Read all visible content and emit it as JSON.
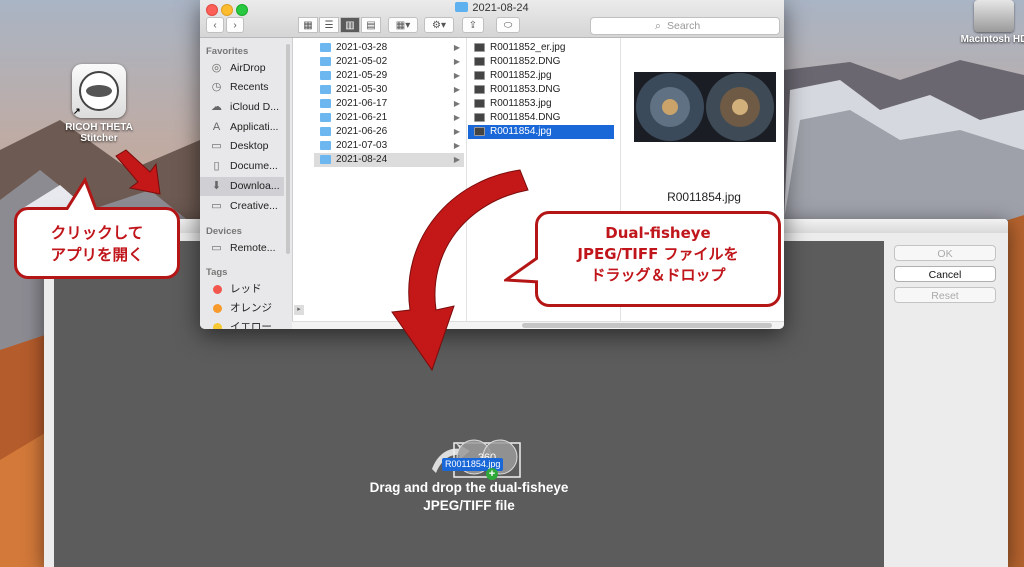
{
  "desktop": {
    "app_icon_label_line1": "RICOH THETA",
    "app_icon_label_line2": "Stitcher",
    "drive_label": "Macintosh HD"
  },
  "finder": {
    "window_title": "2021-08-24",
    "search_placeholder": "Search",
    "sidebar": {
      "favorites_header": "Favorites",
      "favorites": [
        {
          "label": "AirDrop",
          "icon": "airdrop-icon"
        },
        {
          "label": "Recents",
          "icon": "clock-icon"
        },
        {
          "label": "iCloud D...",
          "icon": "cloud-icon"
        },
        {
          "label": "Applicati...",
          "icon": "applications-icon"
        },
        {
          "label": "Desktop",
          "icon": "desktop-icon"
        },
        {
          "label": "Docume...",
          "icon": "document-icon"
        },
        {
          "label": "Downloa...",
          "icon": "download-icon"
        },
        {
          "label": "Creative...",
          "icon": "folder-icon"
        }
      ],
      "devices_header": "Devices",
      "devices": [
        {
          "label": "Remote...",
          "icon": "display-icon"
        }
      ],
      "tags_header": "Tags",
      "tags": [
        {
          "label": "レッド",
          "color": "#f2574d"
        },
        {
          "label": "オレンジ",
          "color": "#f79a2b"
        },
        {
          "label": "イエロー",
          "color": "#f5c933"
        }
      ]
    },
    "folders": [
      "2021-03-28",
      "2021-05-02",
      "2021-05-29",
      "2021-05-30",
      "2021-06-17",
      "2021-06-21",
      "2021-06-26",
      "2021-07-03",
      "2021-08-24"
    ],
    "files": [
      "R0011852_er.jpg",
      "R0011852.DNG",
      "R0011852.jpg",
      "R0011853.DNG",
      "R0011853.jpg",
      "R0011854.DNG",
      "R0011854.jpg"
    ],
    "preview_name": "R0011854.jpg"
  },
  "stitcher": {
    "ok_label": "OK",
    "cancel_label": "Cancel",
    "reset_label": "Reset",
    "icon_text": "360",
    "drop_line1": "Drag and drop the dual-fisheye",
    "drop_line2": "JPEG/TIFF file",
    "drag_ghost_label": "R0011854.jpg"
  },
  "callouts": {
    "left_line1": "クリックして",
    "left_line2": "アプリを開く",
    "right_line1": "Dual-fisheye",
    "right_line2": "JPEG/TIFF ファイルを",
    "right_line3": "ドラッグ＆ドロップ"
  },
  "colors": {
    "callout_border": "#b41616",
    "callout_text": "#c0151a",
    "selection_blue": "#1a68d8",
    "drop_area": "#5c5c5c"
  }
}
